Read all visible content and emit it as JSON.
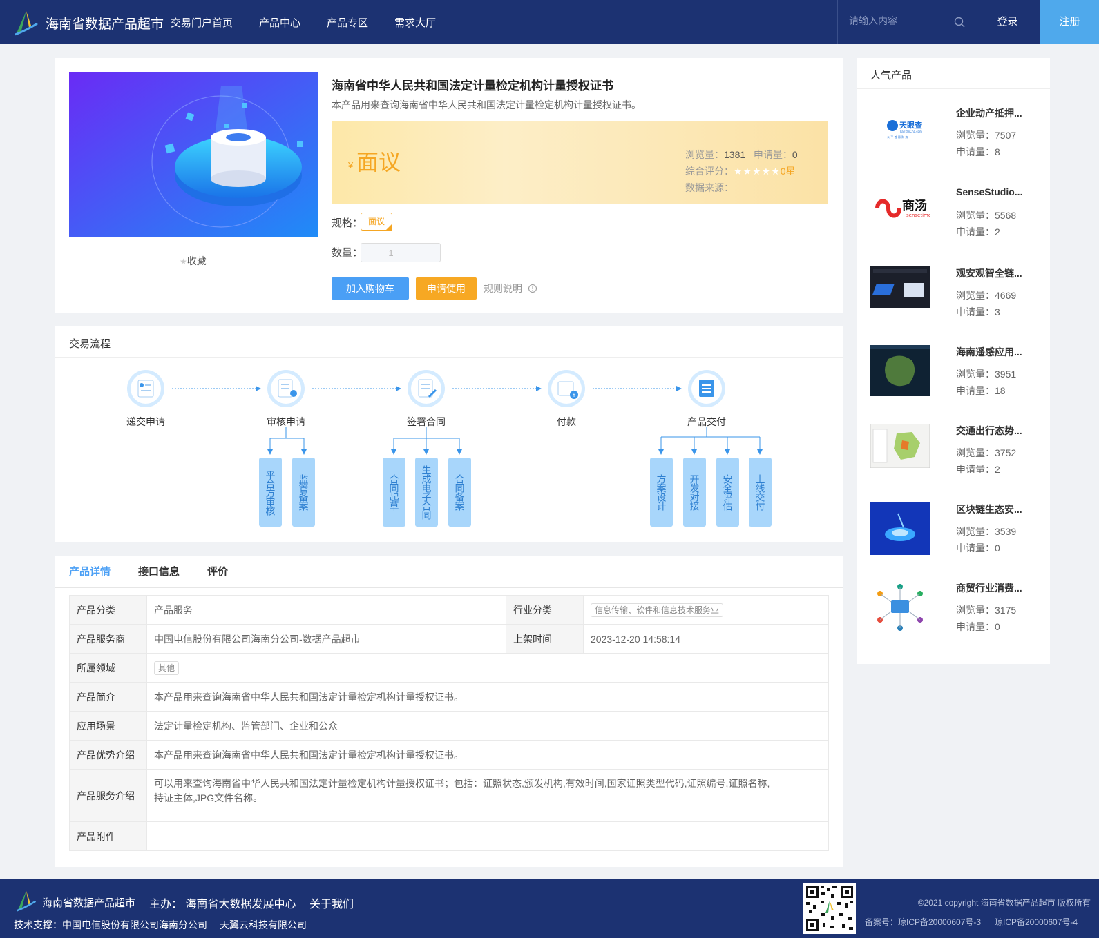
{
  "header": {
    "site_title": "海南省数据产品超市",
    "nav": [
      "交易门户首页",
      "产品中心",
      "产品专区",
      "需求大厅"
    ],
    "search_placeholder": "请输入内容",
    "login": "登录",
    "register": "注册",
    "bg_color": "#1c3272",
    "accent_color": "#4fa9ec"
  },
  "product": {
    "title": "海南省中华人民共和国法定计量检定机构计量授权证书",
    "desc": "本产品用来查询海南省中华人民共和国法定计量检定机构计量授权证书。",
    "currency": "¥",
    "price": "面议",
    "views_label": "浏览量：",
    "views": "1381",
    "applies_label": "申请量：",
    "applies": "0",
    "rating_label": "综合评分：",
    "rating_stars": "★★★★★",
    "rating_text": "0星",
    "rating": 0,
    "source_label": "数据来源：",
    "spec_label": "规格：",
    "spec_value": "面议",
    "qty_label": "数量：",
    "qty": "1",
    "favorite": "收藏",
    "add_cart": "加入购物车",
    "apply_use": "申请使用",
    "rules": "规则说明"
  },
  "flow": {
    "title": "交易流程",
    "steps": [
      "递交申请",
      "审核申请",
      "签署合同",
      "付款",
      "产品交付"
    ],
    "sub_review": [
      "平台方审核",
      "监管备案"
    ],
    "sub_contract": [
      "合同起草",
      "生成电子合同",
      "合同备案"
    ],
    "sub_delivery": [
      "方案设计",
      "开发对接",
      "安全评估",
      "上线交付"
    ]
  },
  "detail": {
    "tabs": [
      "产品详情",
      "接口信息",
      "评价"
    ],
    "rows": {
      "category_k": "产品分类",
      "category_v": "产品服务",
      "industry_k": "行业分类",
      "industry_v": "信息传输、软件和信息技术服务业",
      "provider_k": "产品服务商",
      "provider_v": "中国电信股份有限公司海南分公司-数据产品超市",
      "listed_k": "上架时间",
      "listed_v": "2023-12-20 14:58:14",
      "domain_k": "所属领域",
      "domain_v": "其他",
      "intro_k": "产品简介",
      "intro_v": "本产品用来查询海南省中华人民共和国法定计量检定机构计量授权证书。",
      "scene_k": "应用场景",
      "scene_v": "法定计量检定机构、监管部门、企业和公众",
      "adv_k": "产品优势介绍",
      "adv_v": "本产品用来查询海南省中华人民共和国法定计量检定机构计量授权证书。",
      "svc_k": "产品服务介绍",
      "svc_v1": "可以用来查询海南省中华人民共和国法定计量检定机构计量授权证书；包括：证照状态,颁发机构,有效时间,国家证照类型代码,证照编号,证照名称,",
      "svc_v2": "持证主体,JPG文件名称。",
      "attach_k": "产品附件"
    }
  },
  "hot": {
    "title": "人气产品",
    "views_label": "浏览量：",
    "applies_label": "申请量：",
    "items": [
      {
        "name": "企业动产抵押...",
        "views": "7507",
        "applies": "8"
      },
      {
        "name": "SenseStudio...",
        "views": "5568",
        "applies": "2"
      },
      {
        "name": "观安观智全链...",
        "views": "4669",
        "applies": "3"
      },
      {
        "name": "海南遥感应用...",
        "views": "3951",
        "applies": "18"
      },
      {
        "name": "交通出行态势...",
        "views": "3752",
        "applies": "2"
      },
      {
        "name": "区块链生态安...",
        "views": "3539",
        "applies": "0"
      },
      {
        "name": "商贸行业消费...",
        "views": "3175",
        "applies": "0"
      }
    ],
    "thumb_text_tianyan": "天眼查",
    "thumb_text_tianyan_sub": "TianYanCha.com",
    "thumb_text_tianyan_slogan": "公 平 普 惠 财 务",
    "thumb_text_sense": "商汤",
    "thumb_text_sense_sub": "sensetime"
  },
  "footer": {
    "site_title": "海南省数据产品超市",
    "host": "主办： 海南省大数据发展中心",
    "about": "关于我们",
    "support": "技术支撑：中国电信股份有限公司海南分公司",
    "support2": "天翼云科技有限公司",
    "copyright": "©2021 copyright 海南省数据产品超市 版权所有",
    "icp1": "备案号：琼ICP备20000607号-3",
    "icp2": "琼ICP备20000607号-4"
  }
}
